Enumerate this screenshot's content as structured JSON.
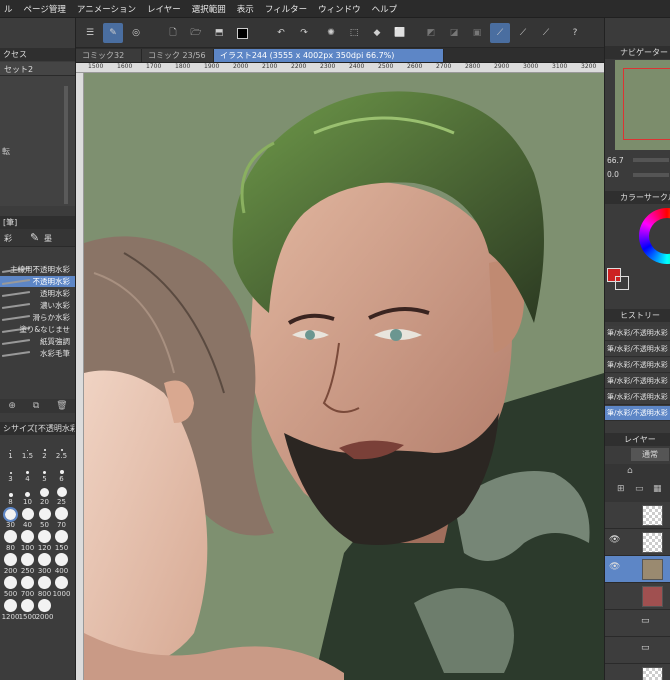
{
  "menubar": {
    "items": [
      "ル",
      "ページ管理",
      "アニメーション",
      "レイヤー",
      "選択範囲",
      "表示",
      "フィルター",
      "ウィンドウ",
      "ヘルプ"
    ]
  },
  "tabs": [
    {
      "label": "コミック32",
      "active": false
    },
    {
      "label": "コミック 23/56",
      "active": false
    },
    {
      "label": "イラスト244 (3555 x 4002px 350dpi 66.7%)",
      "active": true
    }
  ],
  "ruler": {
    "labels": [
      "1500",
      "1600",
      "1700",
      "1800",
      "1900",
      "2000",
      "2100",
      "2200",
      "2300",
      "2400",
      "2500",
      "2600",
      "2700",
      "2800",
      "2900",
      "3000",
      "3100",
      "3200"
    ]
  },
  "left": {
    "panel_title": "クセス",
    "set_label": "セット2",
    "rot_label": "転",
    "brush_header": "[筆]",
    "tool_tabs": [
      "彩",
      "墨"
    ],
    "brushes": [
      {
        "label": "主線用不透明水彩",
        "selected": false
      },
      {
        "label": "不透明水彩",
        "selected": true
      },
      {
        "label": "透明水彩",
        "selected": false
      },
      {
        "label": "濃い水彩",
        "selected": false
      },
      {
        "label": "滑らか水彩",
        "selected": false
      },
      {
        "label": "塗り&なじませ",
        "selected": false
      },
      {
        "label": "紙質強調",
        "selected": false
      },
      {
        "label": "水彩毛筆",
        "selected": false
      }
    ],
    "size_header": "シサイズ[不透明水彩]",
    "sizes": [
      "1",
      "1.5",
      "2",
      "2.5",
      "3",
      "4",
      "5",
      "6",
      "8",
      "10",
      "20",
      "25",
      "30",
      "40",
      "50",
      "70",
      "80",
      "100",
      "120",
      "150",
      "200",
      "250",
      "300",
      "400",
      "500",
      "700",
      "800",
      "1000",
      "1200",
      "1500",
      "2000"
    ],
    "selected_size": "30"
  },
  "right": {
    "navigator_title": "ナビゲーター",
    "zoom": "66.7",
    "rotation": "0.0",
    "color_title": "カラーサークル",
    "history_title": "ヒストリー",
    "history": [
      "筆/水彩/不透明水彩",
      "筆/水彩/不透明水彩",
      "筆/水彩/不透明水彩",
      "筆/水彩/不透明水彩",
      "筆/水彩/不透明水彩",
      "筆/水彩/不透明水彩"
    ],
    "history_selected": 5,
    "layer_title": "レイヤー",
    "blend_mode": "通常"
  },
  "colors": {
    "accent": "#5d86c6",
    "canvas_bg": "#7e9070",
    "main_color": "#cc2222"
  },
  "icons": [
    "menu-icon",
    "pen-tool-icon",
    "select-icon",
    "new-file-icon",
    "open-icon",
    "save-icon",
    "color-icon",
    "undo-icon",
    "redo-icon",
    "loading-icon",
    "clear-icon",
    "fill-icon",
    "transform-icon",
    "help-icon"
  ]
}
